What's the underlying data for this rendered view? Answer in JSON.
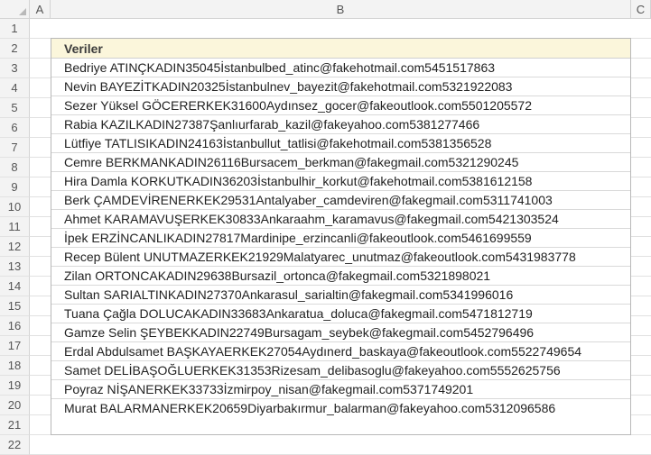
{
  "columns": [
    "A",
    "B",
    "C"
  ],
  "rows": [
    "1",
    "2",
    "3",
    "4",
    "5",
    "6",
    "7",
    "8",
    "9",
    "10",
    "11",
    "12",
    "13",
    "14",
    "15",
    "16",
    "17",
    "18",
    "19",
    "20",
    "21",
    "22"
  ],
  "table": {
    "header": "Veriler",
    "items": [
      "Bedriye ATINÇKADIN35045İstanbulbed_atinc@fakehotmail.com5451517863",
      "Nevin BAYEZİTKADIN20325İstanbulnev_bayezit@fakehotmail.com5321922083",
      "Sezer Yüksel GÖCERERKEK31600Aydınsez_gocer@fakeoutlook.com5501205572",
      "Rabia KAZILKADIN27387Şanlıurfarab_kazil@fakeyahoo.com5381277466",
      "Lütfiye TATLISIKADIN24163İstanbullut_tatlisi@fakehotmail.com5381356528",
      "Cemre BERKMANKADIN26116Bursacem_berkman@fakegmail.com5321290245",
      "Hira Damla KORKUTKADIN36203İstanbulhir_korkut@fakehotmail.com5381612158",
      "Berk ÇAMDEVİRENERKEK29531Antalyaber_camdeviren@fakegmail.com5311741003",
      "Ahmet KARAMAVUŞERKEK30833Ankaraahm_karamavus@fakegmail.com5421303524",
      "İpek ERZİNCANLIKADIN27817Mardinipe_erzincanli@fakeoutlook.com5461699559",
      "Recep Bülent UNUTMAZERKEK21929Malatyarec_unutmaz@fakeoutlook.com5431983778",
      "Zilan ORTONCAKADIN29638Bursazil_ortonca@fakegmail.com5321898021",
      "Sultan SARIALTINKADIN27370Ankarasul_sarialtin@fakegmail.com5341996016",
      "Tuana Çağla DOLUCAKADIN33683Ankaratua_doluca@fakegmail.com5471812719",
      "Gamze Selin ŞEYBEKKADIN22749Bursagam_seybek@fakegmail.com5452796496",
      "Erdal Abdulsamet BAŞKAYAERKEK27054Aydınerd_baskaya@fakeoutlook.com5522749654",
      "Samet DELİBAŞOĞLUERKEK31353Rizesam_delibasoglu@fakeyahoo.com5552625756",
      "Poyraz NİŞANERKEK33733İzmirpoy_nisan@fakegmail.com5371749201",
      "Murat BALARMANERKEK20659Diyarbakırmur_balarman@fakeyahoo.com5312096586"
    ]
  }
}
